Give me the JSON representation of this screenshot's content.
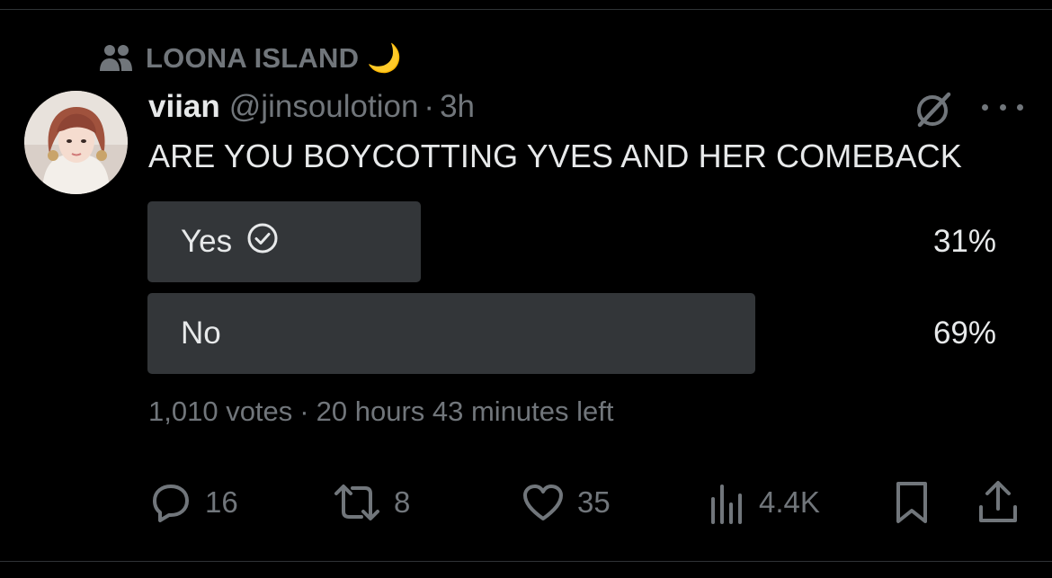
{
  "community": {
    "name": "LOONA ISLAND 🌙",
    "icon": "community-people-icon"
  },
  "tweet": {
    "display_name": "viian",
    "handle": "@jinsoulotion",
    "separator": "·",
    "time": "3h",
    "text": "ARE YOU BOYCOTTING YVES AND HER COMEBACK"
  },
  "poll": {
    "options": [
      {
        "label": "Yes",
        "percent_label": "31%",
        "percent": 31,
        "voted": true
      },
      {
        "label": "No",
        "percent_label": "69%",
        "percent": 69,
        "voted": false
      }
    ],
    "votes": "1,010 votes",
    "separator": "·",
    "time_left": "20 hours 43 minutes left"
  },
  "actions": {
    "replies": "16",
    "reposts": "8",
    "likes": "35",
    "views": "4.4K"
  },
  "colors": {
    "background": "#000000",
    "text_primary": "#e7e9ea",
    "text_secondary": "#71767b",
    "poll_bar": "#333639",
    "divider": "#2f3336"
  }
}
